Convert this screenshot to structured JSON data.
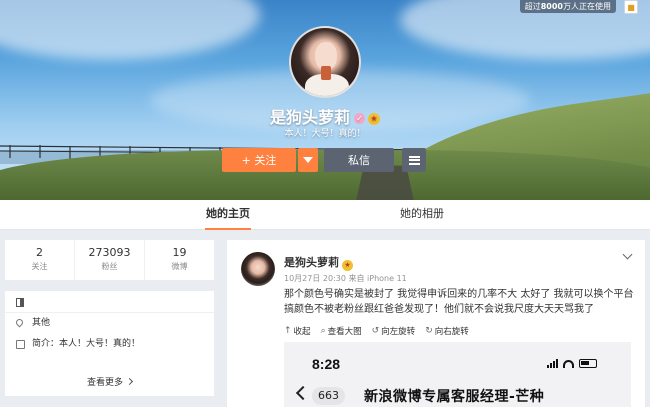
{
  "top_badge": {
    "prefix": "超过",
    "count": "8000",
    "suffix": "万人正在使用"
  },
  "profile": {
    "name": "是狗头萝莉",
    "bio": "本人！大号！真的！",
    "follow_label": "+ 关注",
    "message_label": "私信"
  },
  "tabs": [
    {
      "label": "她的主页",
      "active": true
    },
    {
      "label": "她的相册",
      "active": false
    }
  ],
  "stats": [
    {
      "value": "2",
      "label": "关注"
    },
    {
      "value": "273093",
      "label": "粉丝"
    },
    {
      "value": "19",
      "label": "微博"
    }
  ],
  "info": {
    "location": "其他",
    "intro": "简介：本人！大号！真的！",
    "more_label": "查看更多"
  },
  "post": {
    "author": "是狗头萝莉",
    "meta": "10月27日 20:30 来自 iPhone 11",
    "text": "那个颜色号确实是被封了 我觉得申诉回来的几率不大 太好了 我就可以换个平台搞颜色不被老粉丝跟红爸爸发现了！他们就不会说我尺度大天天骂我了",
    "tools": [
      "收起",
      "查看大图",
      "向左旋转",
      "向右旋转"
    ],
    "image": {
      "time": "8:28",
      "count": "663",
      "title": "新浪微博专属客服经理-芒种"
    }
  },
  "colors": {
    "accent": "#ff8140",
    "dark_button": "#5b6470",
    "page_bg": "#e9edf2"
  }
}
